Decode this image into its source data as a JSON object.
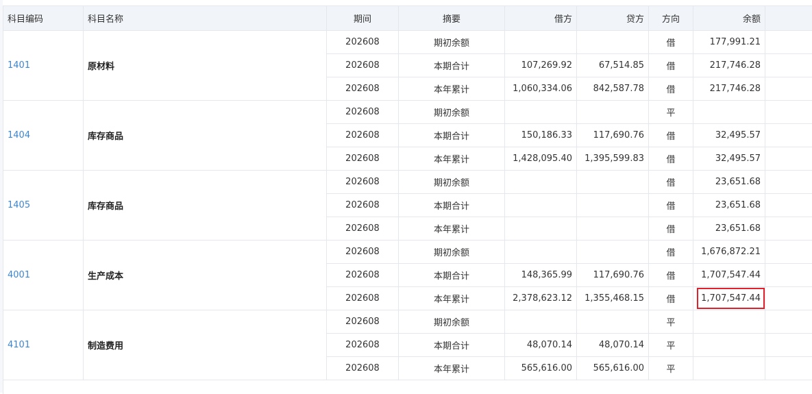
{
  "headers": [
    "科目编码",
    "科目名称",
    "期间",
    "摘要",
    "借方",
    "贷方",
    "方向",
    "余额"
  ],
  "accounts": [
    {
      "code": "1401",
      "name": "原材料",
      "rows": [
        {
          "period": "202608",
          "summary": "期初余额",
          "debit": "",
          "credit": "",
          "direction": "借",
          "balance": "177,991.21"
        },
        {
          "period": "202608",
          "summary": "本期合计",
          "debit": "107,269.92",
          "credit": "67,514.85",
          "direction": "借",
          "balance": "217,746.28"
        },
        {
          "period": "202608",
          "summary": "本年累计",
          "debit": "1,060,334.06",
          "credit": "842,587.78",
          "direction": "借",
          "balance": "217,746.28"
        }
      ]
    },
    {
      "code": "1404",
      "name": "库存商品",
      "rows": [
        {
          "period": "202608",
          "summary": "期初余额",
          "debit": "",
          "credit": "",
          "direction": "平",
          "balance": ""
        },
        {
          "period": "202608",
          "summary": "本期合计",
          "debit": "150,186.33",
          "credit": "117,690.76",
          "direction": "借",
          "balance": "32,495.57"
        },
        {
          "period": "202608",
          "summary": "本年累计",
          "debit": "1,428,095.40",
          "credit": "1,395,599.83",
          "direction": "借",
          "balance": "32,495.57"
        }
      ]
    },
    {
      "code": "1405",
      "name": "库存商品",
      "rows": [
        {
          "period": "202608",
          "summary": "期初余额",
          "debit": "",
          "credit": "",
          "direction": "借",
          "balance": "23,651.68"
        },
        {
          "period": "202608",
          "summary": "本期合计",
          "debit": "",
          "credit": "",
          "direction": "借",
          "balance": "23,651.68"
        },
        {
          "period": "202608",
          "summary": "本年累计",
          "debit": "",
          "credit": "",
          "direction": "借",
          "balance": "23,651.68"
        }
      ]
    },
    {
      "code": "4001",
      "name": "生产成本",
      "rows": [
        {
          "period": "202608",
          "summary": "期初余额",
          "debit": "",
          "credit": "",
          "direction": "借",
          "balance": "1,676,872.21"
        },
        {
          "period": "202608",
          "summary": "本期合计",
          "debit": "148,365.99",
          "credit": "117,690.76",
          "direction": "借",
          "balance": "1,707,547.44"
        },
        {
          "period": "202608",
          "summary": "本年累计",
          "debit": "2,378,623.12",
          "credit": "1,355,468.15",
          "direction": "借",
          "balance": "1,707,547.44",
          "highlighted": true
        }
      ]
    },
    {
      "code": "4101",
      "name": "制造费用",
      "rows": [
        {
          "period": "202608",
          "summary": "期初余额",
          "debit": "",
          "credit": "",
          "direction": "平",
          "balance": ""
        },
        {
          "period": "202608",
          "summary": "本期合计",
          "debit": "48,070.14",
          "credit": "48,070.14",
          "direction": "平",
          "balance": ""
        },
        {
          "period": "202608",
          "summary": "本年累计",
          "debit": "565,616.00",
          "credit": "565,616.00",
          "direction": "平",
          "balance": ""
        }
      ]
    }
  ],
  "colors": {
    "code_link": "#3a86d4",
    "highlight_border": "#e0202a",
    "header_bg": "#f1f4f8",
    "grid": "#e4e8ee"
  }
}
